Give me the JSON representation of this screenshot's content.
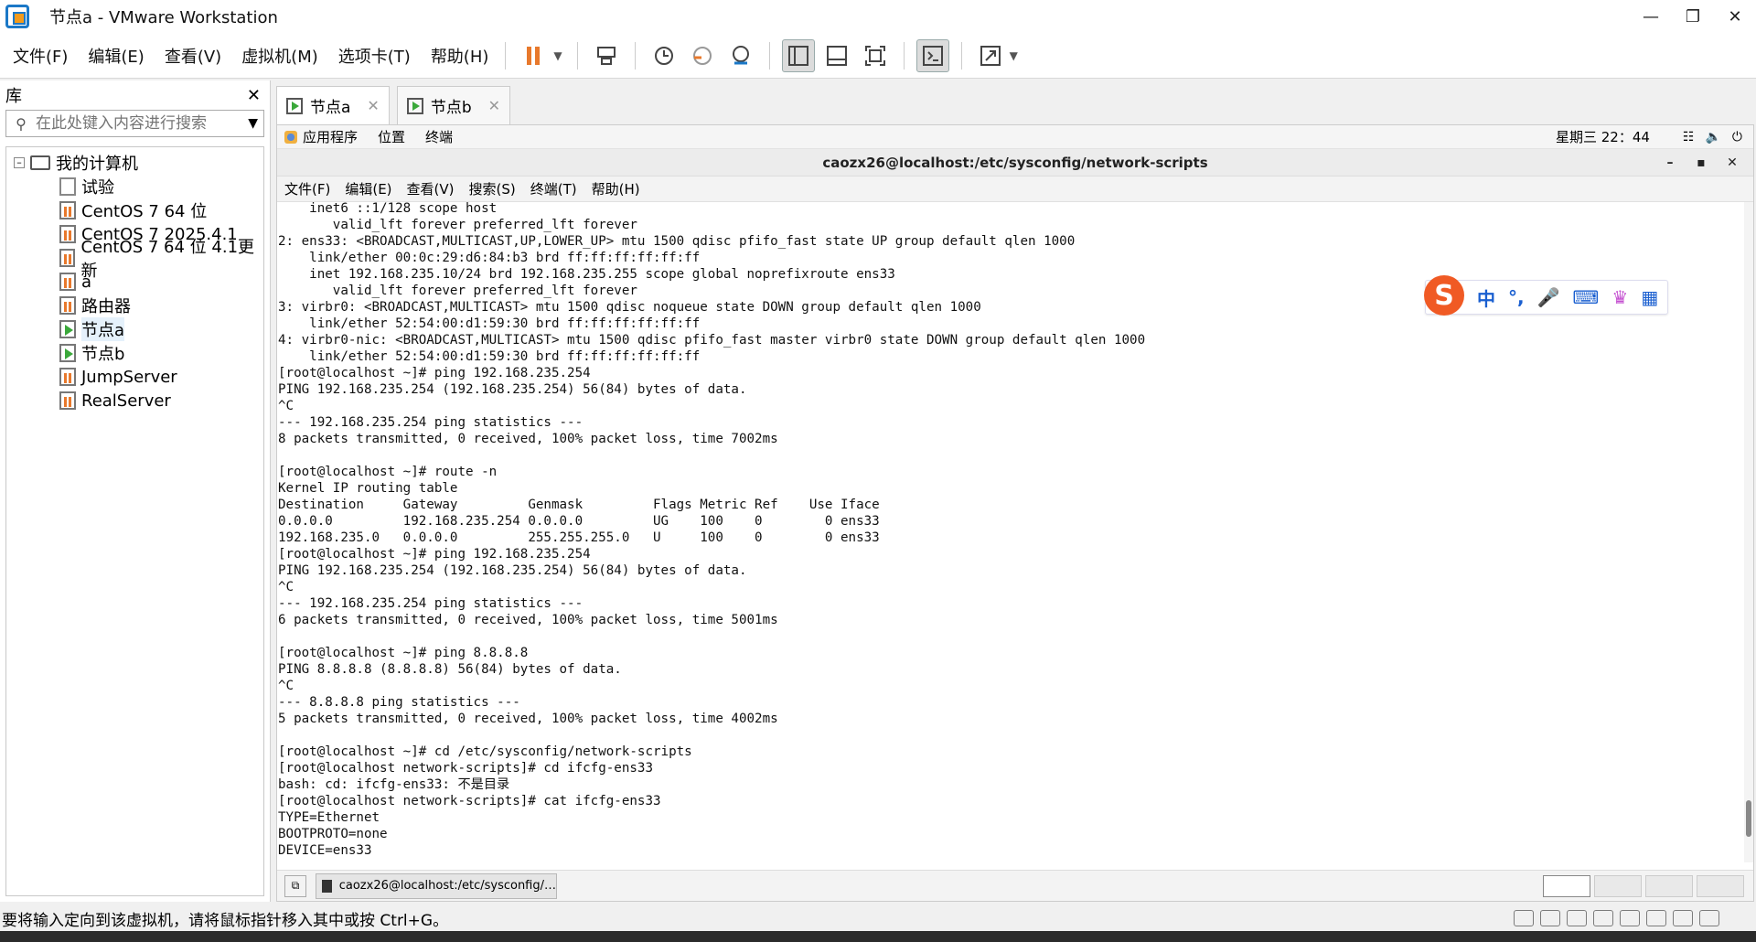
{
  "window": {
    "title": "节点a - VMware Workstation"
  },
  "menubar": {
    "items": [
      "文件(F)",
      "编辑(E)",
      "查看(V)",
      "虚拟机(M)",
      "选项卡(T)",
      "帮助(H)"
    ]
  },
  "library": {
    "title": "库",
    "search_placeholder": "在此处键入内容进行搜索",
    "root": "我的计算机",
    "items": [
      "试验",
      "CentOS 7 64 位",
      "CentOS 7 2025.4.1",
      "CentOS 7 64 位 4.1更新",
      "a",
      "路由器",
      "节点a",
      "节点b",
      "JumpServer",
      "RealServer"
    ]
  },
  "tabs": [
    {
      "label": "节点a",
      "active": true
    },
    {
      "label": "节点b",
      "active": false
    }
  ],
  "gnome": {
    "apps": "应用程序",
    "places": "位置",
    "terminal": "终端",
    "clock": "星期三 22：44"
  },
  "terminal": {
    "title": "caozx26@localhost:/etc/sysconfig/network-scripts",
    "menu": [
      "文件(F)",
      "编辑(E)",
      "查看(V)",
      "搜索(S)",
      "终端(T)",
      "帮助(H)"
    ],
    "output": "    inet6 ::1/128 scope host \n       valid_lft forever preferred_lft forever\n2: ens33: <BROADCAST,MULTICAST,UP,LOWER_UP> mtu 1500 qdisc pfifo_fast state UP group default qlen 1000\n    link/ether 00:0c:29:d6:84:b3 brd ff:ff:ff:ff:ff:ff\n    inet 192.168.235.10/24 brd 192.168.235.255 scope global noprefixroute ens33\n       valid_lft forever preferred_lft forever\n3: virbr0: <BROADCAST,MULTICAST> mtu 1500 qdisc noqueue state DOWN group default qlen 1000\n    link/ether 52:54:00:d1:59:30 brd ff:ff:ff:ff:ff:ff\n4: virbr0-nic: <BROADCAST,MULTICAST> mtu 1500 qdisc pfifo_fast master virbr0 state DOWN group default qlen 1000\n    link/ether 52:54:00:d1:59:30 brd ff:ff:ff:ff:ff:ff\n[root@localhost ~]# ping 192.168.235.254\nPING 192.168.235.254 (192.168.235.254) 56(84) bytes of data.\n^C\n--- 192.168.235.254 ping statistics ---\n8 packets transmitted, 0 received, 100% packet loss, time 7002ms\n\n[root@localhost ~]# route -n\nKernel IP routing table\nDestination     Gateway         Genmask         Flags Metric Ref    Use Iface\n0.0.0.0         192.168.235.254 0.0.0.0         UG    100    0        0 ens33\n192.168.235.0   0.0.0.0         255.255.255.0   U     100    0        0 ens33\n[root@localhost ~]# ping 192.168.235.254\nPING 192.168.235.254 (192.168.235.254) 56(84) bytes of data.\n^C\n--- 192.168.235.254 ping statistics ---\n6 packets transmitted, 0 received, 100% packet loss, time 5001ms\n\n[root@localhost ~]# ping 8.8.8.8\nPING 8.8.8.8 (8.8.8.8) 56(84) bytes of data.\n^C\n--- 8.8.8.8 ping statistics ---\n5 packets transmitted, 0 received, 100% packet loss, time 4002ms\n\n[root@localhost ~]# cd /etc/sysconfig/network-scripts\n[root@localhost network-scripts]# cd ifcfg-ens33\nbash: cd: ifcfg-ens33: 不是目录\n[root@localhost network-scripts]# cat ifcfg-ens33\nTYPE=Ethernet\nBOOTPROTO=none\nDEVICE=ens33"
  },
  "ime": {
    "logo": "S",
    "mode": "中",
    "punct": "°,"
  },
  "taskbar": {
    "item": "caozx26@localhost:/etc/sysconfig/…"
  },
  "statusbar": {
    "message": "要将输入定向到该虚拟机，请将鼠标指针移入其中或按 Ctrl+G。"
  }
}
